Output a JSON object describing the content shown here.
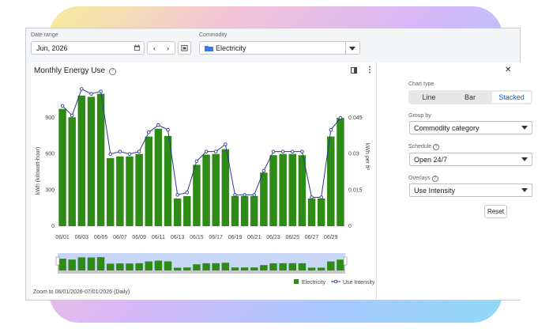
{
  "header": {
    "date_range_label": "Date range",
    "date_value": "Jun, 2026",
    "commodity_label": "Commodity",
    "commodity_value": "Electricity"
  },
  "chart_panel": {
    "title": "Monthly Energy Use",
    "footer": "Zoom to 06/01/2026-07/01/2026 (Daily)"
  },
  "side_panel": {
    "chart_type_label": "Chart type",
    "chart_types": [
      "Line",
      "Bar",
      "Stacked"
    ],
    "selected_chart_type": "Stacked",
    "group_by_label": "Group by",
    "group_by_value": "Commodity category",
    "schedule_label": "Schedule",
    "schedule_value": "Open 24/7",
    "overlays_label": "Overlays",
    "overlays_value": "Use Intensity",
    "reset_label": "Reset"
  },
  "colors": {
    "bar": "#2e8b16",
    "line": "#2a3a8f",
    "accent": "#1a73e8"
  },
  "chart_data": {
    "type": "bar",
    "x": [
      "06/01",
      "06/02",
      "06/03",
      "06/04",
      "06/05",
      "06/06",
      "06/07",
      "06/08",
      "06/09",
      "06/10",
      "06/11",
      "06/12",
      "06/13",
      "06/14",
      "06/15",
      "06/16",
      "06/17",
      "06/18",
      "06/19",
      "06/20",
      "06/21",
      "06/22",
      "06/23",
      "06/24",
      "06/25",
      "06/26",
      "06/27",
      "06/28",
      "06/29",
      "06/30"
    ],
    "x_tick_labels": [
      "06/01",
      "06/03",
      "06/05",
      "06/07",
      "06/09",
      "06/11",
      "06/13",
      "06/15",
      "06/17",
      "06/19",
      "06/21",
      "06/23",
      "06/25",
      "06/27",
      "06/29"
    ],
    "series": [
      {
        "name": "Electricity",
        "axis": "left",
        "kind": "bar",
        "values": [
          975,
          905,
          1085,
          1075,
          1100,
          565,
          580,
          580,
          600,
          745,
          810,
          750,
          230,
          250,
          510,
          595,
          600,
          640,
          250,
          250,
          250,
          445,
          590,
          600,
          600,
          590,
          230,
          230,
          745,
          900
        ]
      },
      {
        "name": "Use Intensity",
        "axis": "right",
        "kind": "line",
        "values": [
          0.05,
          0.046,
          0.057,
          0.055,
          0.056,
          0.03,
          0.031,
          0.03,
          0.031,
          0.039,
          0.042,
          0.04,
          0.013,
          0.014,
          0.027,
          0.031,
          0.031,
          0.034,
          0.013,
          0.013,
          0.013,
          0.023,
          0.031,
          0.031,
          0.031,
          0.031,
          0.012,
          0.012,
          0.04,
          0.045
        ]
      }
    ],
    "y_left": {
      "label": "kWh (kilowatt-hour)",
      "ticks": [
        "0",
        "300",
        "600",
        "900"
      ],
      "range": [
        0,
        1150
      ]
    },
    "y_right": {
      "label": "kWh per ft²",
      "ticks": [
        "0",
        "0.015",
        "0.03",
        "0.045"
      ],
      "range": [
        0,
        0.0575
      ]
    },
    "legend": [
      "Electricity",
      "Use Intensity"
    ],
    "legend_position": "bottom-right",
    "grid": false
  }
}
